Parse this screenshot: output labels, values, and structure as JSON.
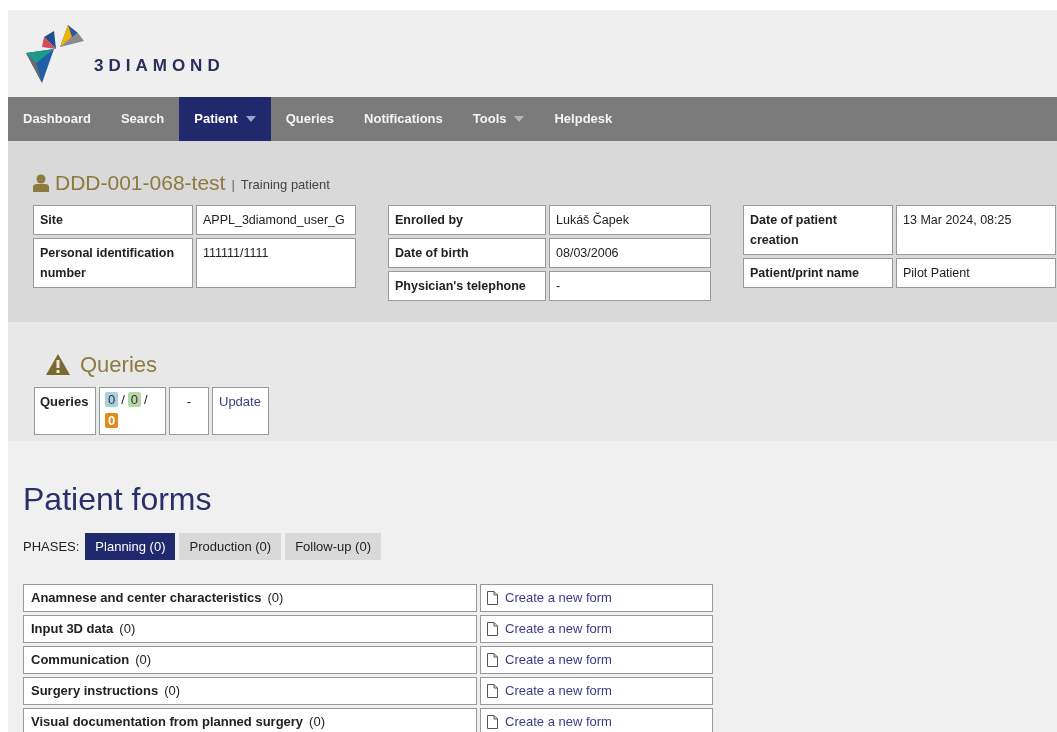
{
  "logo": {
    "text": "3DIAMOND"
  },
  "nav": [
    {
      "label": "Dashboard",
      "selected": false,
      "dropdown": false
    },
    {
      "label": "Search",
      "selected": false,
      "dropdown": false
    },
    {
      "label": "Patient",
      "selected": true,
      "dropdown": true
    },
    {
      "label": "Queries",
      "selected": false,
      "dropdown": false
    },
    {
      "label": "Notifications",
      "selected": false,
      "dropdown": false
    },
    {
      "label": "Tools",
      "selected": false,
      "dropdown": true
    },
    {
      "label": "Helpdesk",
      "selected": false,
      "dropdown": false
    }
  ],
  "patient": {
    "id": "DDD-001-068-test",
    "separator": "|",
    "note": "Training patient",
    "field_groups": [
      [
        {
          "label": "Site",
          "value": "APPL_3diamond_user_G"
        },
        {
          "label": "Personal identification number",
          "value": "111111/1111"
        }
      ],
      [
        {
          "label": "Enrolled by",
          "value": "Lukáš Čapek"
        },
        {
          "label": "Date of birth",
          "value": "08/03/2006"
        },
        {
          "label": "Physician's telephone",
          "value": "-"
        }
      ],
      [
        {
          "label": "Date of patient creation",
          "value": "13 Mar 2024, 08:25"
        },
        {
          "label": "Patient/print name",
          "value": "Pilot Patient"
        }
      ]
    ]
  },
  "queries": {
    "title": "Queries",
    "label": "Queries",
    "counts": [
      {
        "value": "0",
        "color": "#a9cfe0"
      },
      {
        "value": "0",
        "color": "#b7d7a8"
      },
      {
        "value": "0",
        "color": "#e08a1e"
      }
    ],
    "separator": "/",
    "status": "-",
    "action": "Update"
  },
  "forms": {
    "title": "Patient forms",
    "phases_label": "PHASES:",
    "phases": [
      {
        "label": "Planning (0)",
        "selected": true
      },
      {
        "label": "Production (0)",
        "selected": false
      },
      {
        "label": "Follow-up (0)",
        "selected": false
      }
    ],
    "rows": [
      {
        "name": "Anamnese and center characteristics",
        "count": "(0)",
        "action": "Create a new form"
      },
      {
        "name": "Input 3D data",
        "count": "(0)",
        "action": "Create a new form"
      },
      {
        "name": "Communication",
        "count": "(0)",
        "action": "Create a new form"
      },
      {
        "name": "Surgery instructions",
        "count": "(0)",
        "action": "Create a new form"
      },
      {
        "name": "Visual documentation from planned surgery",
        "count": "(0)",
        "action": "Create a new form"
      }
    ]
  }
}
